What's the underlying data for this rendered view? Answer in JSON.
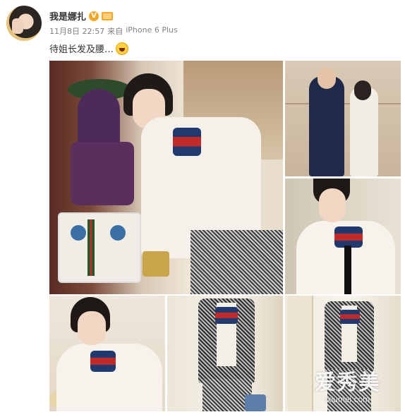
{
  "post": {
    "username": "我是娜扎",
    "verified_badge": "V",
    "date": "11月8日 22:57",
    "source_prefix": "来自",
    "device": "iPhone 6 Plus",
    "text": "待姐长发及腰…",
    "emoji": "laugh-emoji"
  },
  "images": [
    {
      "id": "img-main",
      "description": "woman in boutique with mannequins and bag"
    },
    {
      "id": "img-tr",
      "description": "woman with man in suit in store"
    },
    {
      "id": "img-mr",
      "description": "close-up with striped bow"
    },
    {
      "id": "img-bl",
      "description": "portrait with hand near face"
    },
    {
      "id": "img-bm",
      "description": "woman in tweed jacket"
    },
    {
      "id": "img-br",
      "description": "woman in tweed outfit near door"
    }
  ],
  "watermark": {
    "main": "爱秀美",
    "sub": "ixiumei.com"
  },
  "colors": {
    "username": "#333333",
    "meta": "#808080",
    "badge": "#f5a623"
  }
}
